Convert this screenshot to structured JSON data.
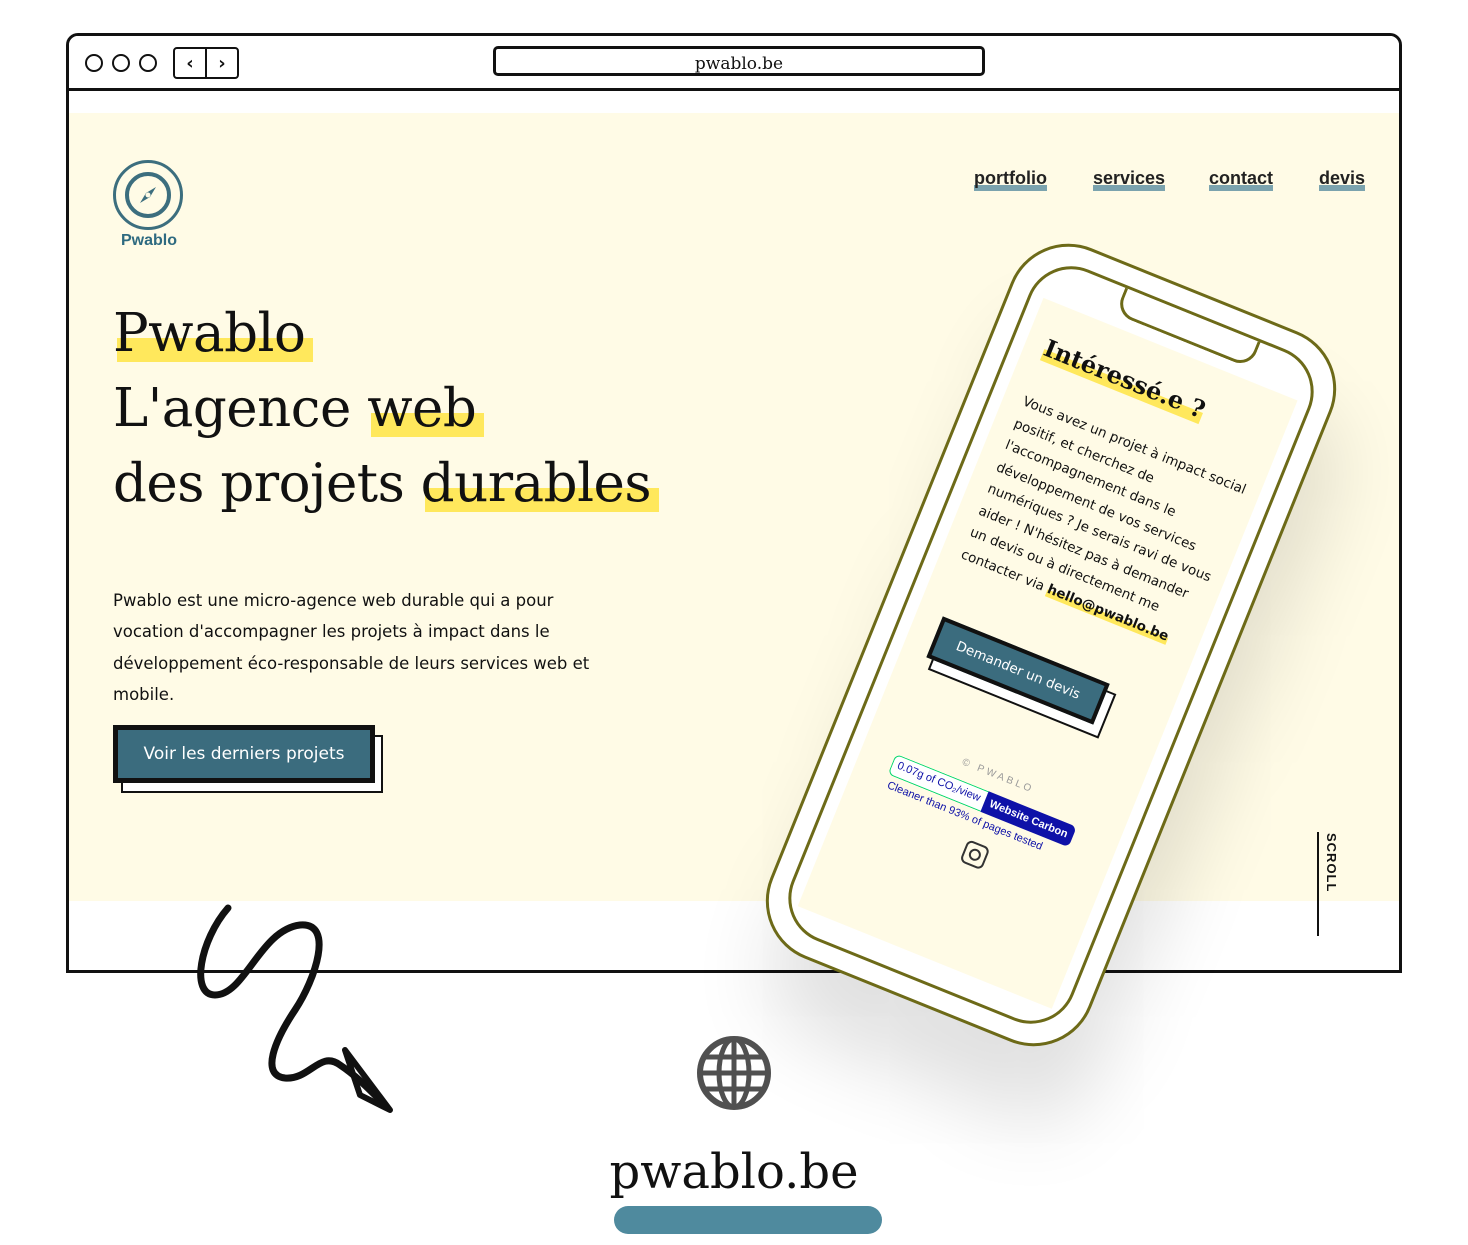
{
  "browser": {
    "url": "pwablo.be"
  },
  "site": {
    "logo_text": "Pwablo",
    "nav": [
      "portfolio",
      "services",
      "contact",
      "devis"
    ],
    "headline": {
      "line1": "Pwablo",
      "line2_plain": "L'agence ",
      "line2_highlight": "web",
      "line3_plain": "des projets ",
      "line3_highlight": "durables"
    },
    "intro": "Pwablo est une micro-agence web durable qui a pour vocation d'accompagner les projets à impact dans le développement éco-responsable de leurs services web et mobile.",
    "cta": "Voir les derniers projets",
    "scroll": "SCROLL"
  },
  "phone": {
    "title": "Intéressé.e ?",
    "text": "Vous avez un projet à impact social positif, et cherchez de l'accompagnement dans le développement de vos services numériques ? Je serais ravi de vous aider ! N'hésitez pas à demander un devis ou à directement me contacter via ",
    "email": "hello@pwablo.be",
    "button": "Demander un devis",
    "copyright": "© PWABLO",
    "carbon_value": "0.07g of CO₂/view",
    "carbon_label": "Website Carbon",
    "carbon_cleaner": "Cleaner than 93% of pages tested"
  },
  "footer": {
    "url": "pwablo.be"
  },
  "colors": {
    "accent": "#3b6c7e",
    "highlight": "#ffe85c",
    "hero_bg": "#fffbe6",
    "phone_frame": "#6d6a18"
  },
  "icons": [
    "compass-icon",
    "globe-icon",
    "instagram-icon",
    "arrow-squiggle"
  ]
}
